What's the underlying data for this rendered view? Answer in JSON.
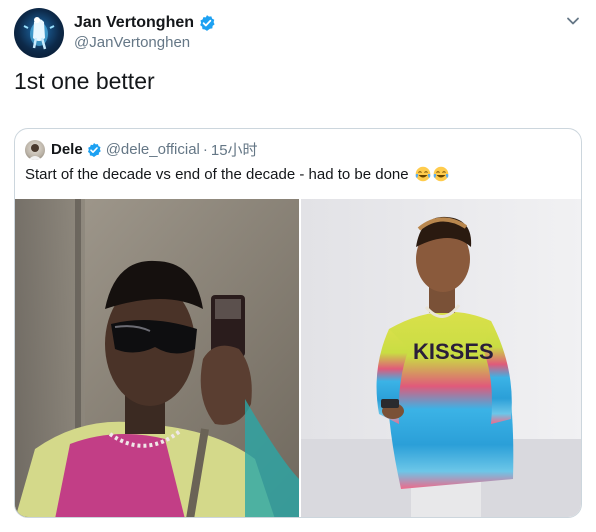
{
  "author": {
    "name": "Jan Vertonghen",
    "handle": "@JanVertonghen",
    "avatar_icon": "spurs-cockerel-avatar",
    "verified": true
  },
  "tweet": {
    "text": "1st one better"
  },
  "quoted": {
    "name": "Dele",
    "handle": "@dele_official",
    "separator": "·",
    "time": "15小时",
    "text": "Start of the decade vs end of the decade - had to be done",
    "emojis": [
      "face-with-tears-of-joy",
      "face-with-tears-of-joy"
    ],
    "verified": true
  },
  "media": {
    "left_icon": "selfie-photo",
    "right_icon": "colorful-sweater-photo"
  },
  "colors": {
    "verified_blue": "#1da1f2",
    "secondary_text": "#657786",
    "border": "#ccd6dd"
  }
}
